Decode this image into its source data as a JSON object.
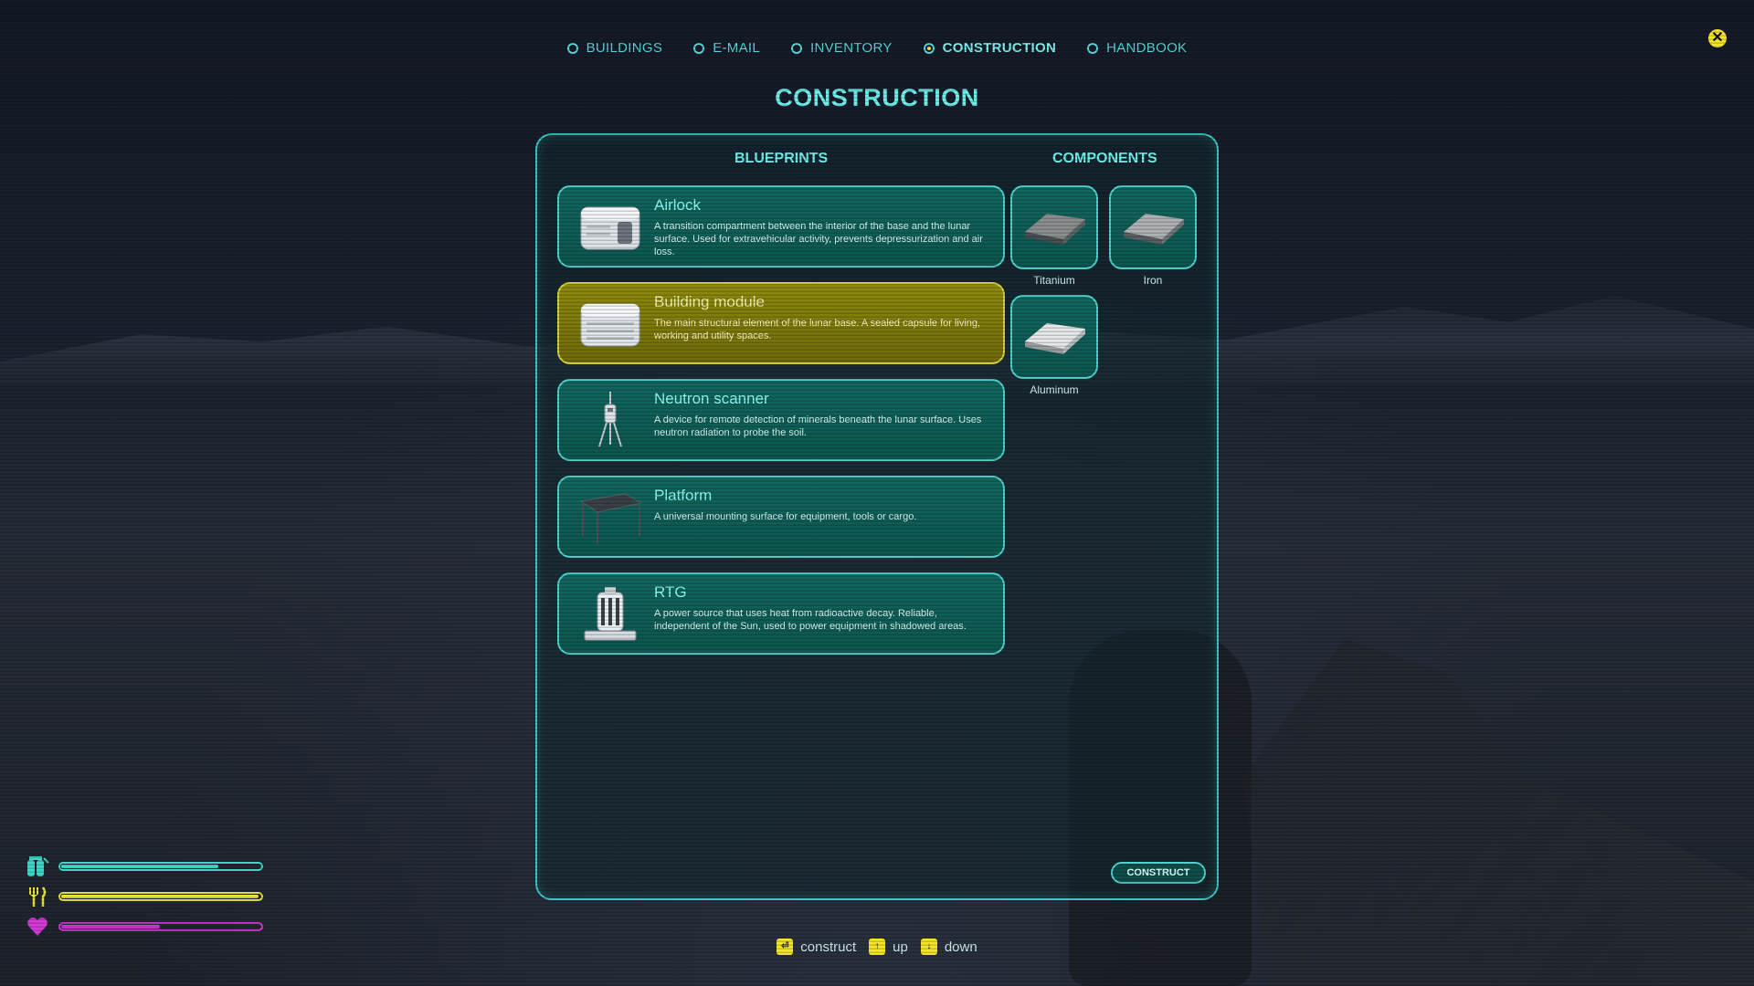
{
  "tabs": [
    {
      "label": "BUILDINGS",
      "active": false
    },
    {
      "label": "E-MAIL",
      "active": false
    },
    {
      "label": "INVENTORY",
      "active": false
    },
    {
      "label": "CONSTRUCTION",
      "active": true
    },
    {
      "label": "HANDBOOK",
      "active": false
    }
  ],
  "close_icon": "close-icon",
  "page_title": "CONSTRUCTION",
  "blueprints": {
    "heading": "BLUEPRINTS",
    "items": [
      {
        "name": "Airlock",
        "description": "A transition compartment between the interior of the base and the lunar surface. Used for extravehicular activity, prevents depressurization and air loss.",
        "selected": false,
        "icon": "airlock-icon"
      },
      {
        "name": "Building module",
        "description": "The main structural element of the lunar base. A sealed capsule for living, working and utility spaces.",
        "selected": true,
        "icon": "building-module-icon"
      },
      {
        "name": "Neutron scanner",
        "description": "A device for remote detection of minerals beneath the lunar surface. Uses neutron radiation to probe the soil.",
        "selected": false,
        "icon": "neutron-scanner-icon"
      },
      {
        "name": "Platform",
        "description": "A universal mounting surface for equipment, tools or cargo.",
        "selected": false,
        "icon": "platform-icon"
      },
      {
        "name": "RTG",
        "description": "A power source that uses heat from radioactive decay. Reliable, independent of the Sun, used to power equipment in shadowed areas.",
        "selected": false,
        "icon": "rtg-icon"
      }
    ]
  },
  "components": {
    "heading": "COMPONENTS",
    "items": [
      {
        "label": "Titanium",
        "icon": "titanium-ingot-icon"
      },
      {
        "label": "Iron",
        "icon": "iron-ingot-icon"
      },
      {
        "label": "Aluminum",
        "icon": "aluminum-ingot-icon"
      }
    ]
  },
  "construct_button": "CONSTRUCT",
  "hints": [
    {
      "key": "enter",
      "label": "construct"
    },
    {
      "key": "↑",
      "label": "up"
    },
    {
      "key": "↓",
      "label": "down"
    }
  ],
  "status": {
    "oxygen": {
      "icon": "oxygen-tank-icon",
      "level": 0.79,
      "color": "#3fd6c8"
    },
    "food": {
      "icon": "fork-knife-icon",
      "level": 0.99,
      "color": "#e8e43a"
    },
    "health": {
      "icon": "heart-icon",
      "level": 0.5,
      "color": "#d23bd6"
    }
  },
  "colors": {
    "accent": "#6ff0ec",
    "selected": "#d8d23a",
    "key_yellow": "#f2e52b"
  }
}
